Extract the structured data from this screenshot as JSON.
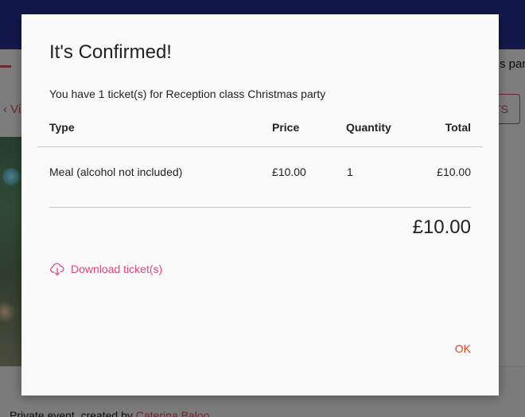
{
  "background": {
    "subbar_right_text": "s par",
    "view_link": "Vie",
    "tickets_button": "TS",
    "footer": {
      "prefix": "Private event, created by ",
      "creator": "Caterina Baloo"
    }
  },
  "modal": {
    "title": "It's Confirmed!",
    "subtitle": "You have 1 ticket(s) for Reception class Christmas party",
    "columns": {
      "type": "Type",
      "price": "Price",
      "quantity": "Quantity",
      "total": "Total"
    },
    "rows": [
      {
        "type": "Meal (alcohol not included)",
        "price": "£10.00",
        "quantity": "1",
        "total": "£10.00"
      }
    ],
    "grand_total": "£10.00",
    "download_label": "Download ticket(s)",
    "download_icon": "cloud-download-icon",
    "ok_label": "OK"
  },
  "colors": {
    "header": "#12194a",
    "link_pink": "#e5457c",
    "ok_orange": "#d8431c"
  }
}
